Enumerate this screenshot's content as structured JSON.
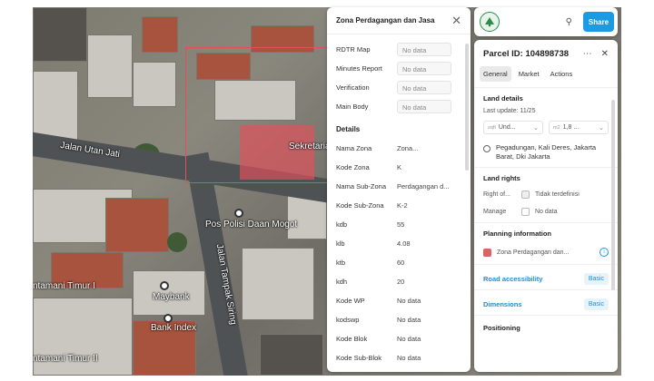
{
  "map": {
    "street_labels": [
      "Jalan Utan Jati",
      "Jalan Tampak Siring",
      "ntamani Timur I",
      "ntamani Timur II"
    ],
    "poi_labels": [
      "Pos Polisi Daan Mogot",
      "Maybank",
      "Bank Index",
      "Sekretariat"
    ],
    "parcel_color": "#e0505a"
  },
  "zone_panel": {
    "title": "Zona Perdagangan dan Jasa",
    "top_rows": [
      {
        "label": "RDTR Map",
        "value": "No data"
      },
      {
        "label": "Minutes Report",
        "value": "No data"
      },
      {
        "label": "Verification",
        "value": "No data"
      },
      {
        "label": "Main Body",
        "value": "No data"
      }
    ],
    "details_heading": "Details",
    "details": [
      {
        "label": "Nama Zona",
        "value": "Zona..."
      },
      {
        "label": "Kode Zona",
        "value": "K"
      },
      {
        "label": "Nama Sub-Zona",
        "value": "Perdagangan d..."
      },
      {
        "label": "Kode Sub-Zona",
        "value": "K-2"
      },
      {
        "label": "kdb",
        "value": "55"
      },
      {
        "label": "klb",
        "value": "4.08"
      },
      {
        "label": "ktb",
        "value": "60"
      },
      {
        "label": "kdh",
        "value": "20"
      },
      {
        "label": "Kode WP",
        "value": "No data"
      },
      {
        "label": "kodswp",
        "value": "No data"
      },
      {
        "label": "Kode Blok",
        "value": "No data"
      },
      {
        "label": "Kode Sub-Blok",
        "value": "No data"
      }
    ]
  },
  "toolbar": {
    "share_label": "Share",
    "lang_icon": "translate-icon",
    "accent": "#1a9be3"
  },
  "parcel": {
    "title": "Parcel ID: 104898738",
    "tabs": [
      "General",
      "Market",
      "Actions"
    ],
    "land_details_heading": "Land details",
    "last_update": "Last update: 11/25",
    "area_unit_1": "sqft",
    "area_value_1": "Und...",
    "area_unit_2": "m2",
    "area_value_2": "1,8 ...",
    "address": "Pegadungan, Kali Deres, Jakarta Barat, Dki Jakarta",
    "land_rights_heading": "Land rights",
    "right_of_label": "Right of...",
    "right_of_value": "Tidak terdefinisi",
    "manage_label": "Manage",
    "manage_value": "No data",
    "planning_heading": "Planning information",
    "planning_zone": "Zona Perdagangan dan...",
    "zone_color": "#e06068",
    "road_access_label": "Road accessibility",
    "road_access_badge": "Basic",
    "dimensions_label": "Dimensions",
    "dimensions_badge": "Basic",
    "positioning_label": "Positioning"
  }
}
